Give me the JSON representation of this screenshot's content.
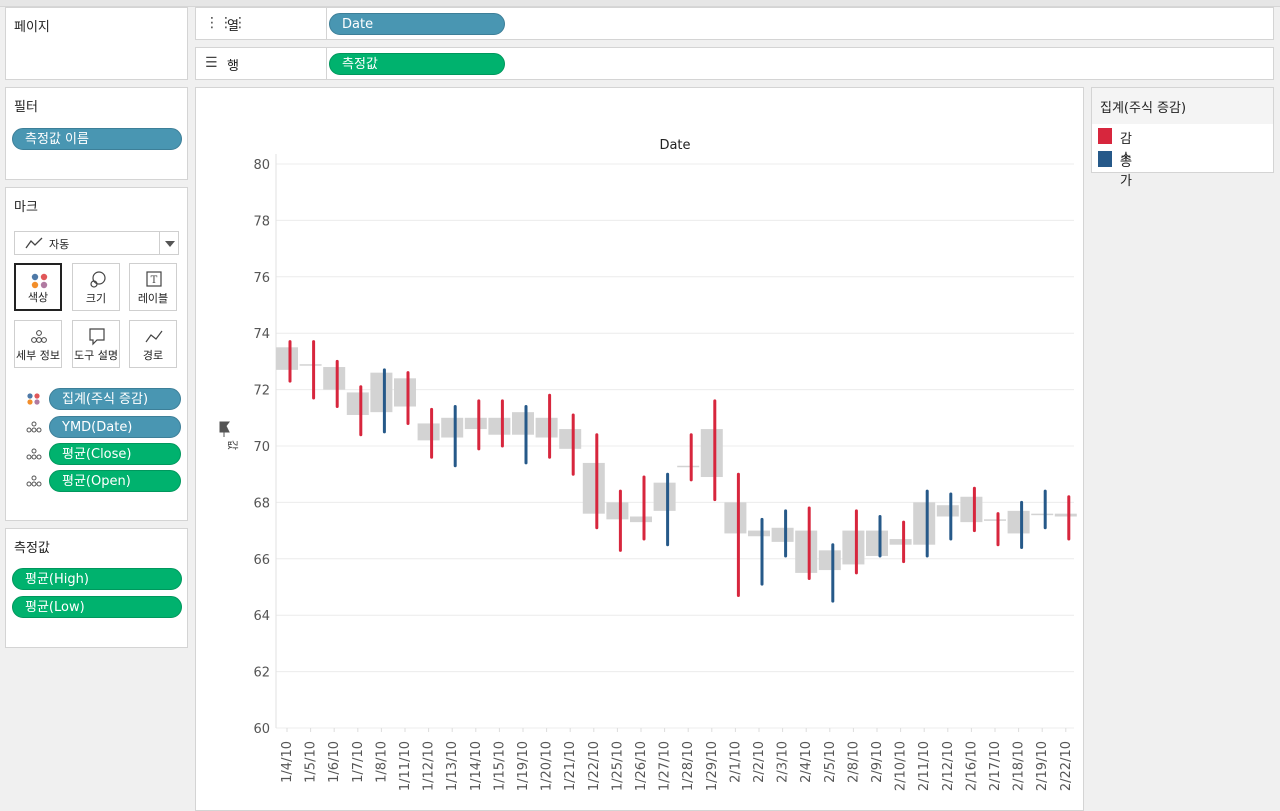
{
  "shelves": {
    "pages_title": "페이지",
    "columns_label": "열",
    "columns_pill": "Date",
    "rows_label": "행",
    "rows_pill": "측정값"
  },
  "filters": {
    "title": "필터",
    "pill": "측정값 이름"
  },
  "marks": {
    "title": "마크",
    "type_dropdown": "자동",
    "buttons": {
      "color": "색상",
      "size": "크기",
      "label": "레이블",
      "detail": "세부 정보",
      "tooltip": "도구 설명",
      "path": "경로"
    },
    "fields": [
      "집계(주식 증감)",
      "YMD(Date)",
      "평균(Close)",
      "평균(Open)"
    ]
  },
  "measures": {
    "title": "측정값",
    "items": [
      "평균(High)",
      "평균(Low)"
    ]
  },
  "legend": {
    "title": "집계(주식 증감)",
    "items": [
      {
        "label": "감소",
        "color": "#d7263d"
      },
      {
        "label": "증가",
        "color": "#265989"
      }
    ]
  },
  "chart_data": {
    "type": "candlestick",
    "title": "Date",
    "ylabel": "값",
    "ylim": [
      60,
      80
    ],
    "yticks": [
      60,
      62,
      64,
      66,
      68,
      70,
      72,
      74,
      76,
      78,
      80
    ],
    "categories": [
      "1/4/10",
      "1/5/10",
      "1/6/10",
      "1/7/10",
      "1/8/10",
      "1/11/10",
      "1/12/10",
      "1/13/10",
      "1/14/10",
      "1/15/10",
      "1/19/10",
      "1/20/10",
      "1/21/10",
      "1/22/10",
      "1/25/10",
      "1/26/10",
      "1/27/10",
      "1/28/10",
      "1/29/10",
      "2/1/10",
      "2/2/10",
      "2/3/10",
      "2/4/10",
      "2/5/10",
      "2/8/10",
      "2/9/10",
      "2/10/10",
      "2/11/10",
      "2/12/10",
      "2/16/10",
      "2/17/10",
      "2/18/10",
      "2/19/10",
      "2/22/10"
    ],
    "series": [
      {
        "name": "감소",
        "color": "#d7263d"
      },
      {
        "name": "증가",
        "color": "#265989"
      }
    ],
    "body_color": "#d3d3d3",
    "candles": [
      {
        "date": "1/4/10",
        "open": 73.5,
        "close": 72.7,
        "high": 73.7,
        "low": 72.3,
        "trend": "감소"
      },
      {
        "date": "1/5/10",
        "open": 72.9,
        "close": 72.9,
        "high": 73.7,
        "low": 71.7,
        "trend": "감소"
      },
      {
        "date": "1/6/10",
        "open": 72.8,
        "close": 72.0,
        "high": 73.0,
        "low": 71.4,
        "trend": "감소"
      },
      {
        "date": "1/7/10",
        "open": 71.9,
        "close": 71.1,
        "high": 72.1,
        "low": 70.4,
        "trend": "감소"
      },
      {
        "date": "1/8/10",
        "open": 71.2,
        "close": 72.6,
        "high": 72.7,
        "low": 70.5,
        "trend": "증가"
      },
      {
        "date": "1/11/10",
        "open": 72.4,
        "close": 71.4,
        "high": 72.6,
        "low": 70.8,
        "trend": "감소"
      },
      {
        "date": "1/12/10",
        "open": 70.8,
        "close": 70.2,
        "high": 71.3,
        "low": 69.6,
        "trend": "감소"
      },
      {
        "date": "1/13/10",
        "open": 70.3,
        "close": 71.0,
        "high": 71.4,
        "low": 69.3,
        "trend": "증가"
      },
      {
        "date": "1/14/10",
        "open": 71.0,
        "close": 70.6,
        "high": 71.6,
        "low": 69.9,
        "trend": "감소"
      },
      {
        "date": "1/15/10",
        "open": 71.0,
        "close": 70.4,
        "high": 71.6,
        "low": 70.0,
        "trend": "감소"
      },
      {
        "date": "1/19/10",
        "open": 70.4,
        "close": 71.2,
        "high": 71.4,
        "low": 69.4,
        "trend": "증가"
      },
      {
        "date": "1/20/10",
        "open": 71.0,
        "close": 70.3,
        "high": 71.8,
        "low": 69.6,
        "trend": "감소"
      },
      {
        "date": "1/21/10",
        "open": 70.6,
        "close": 69.9,
        "high": 71.1,
        "low": 69.0,
        "trend": "감소"
      },
      {
        "date": "1/22/10",
        "open": 69.4,
        "close": 67.6,
        "high": 70.4,
        "low": 67.1,
        "trend": "감소"
      },
      {
        "date": "1/25/10",
        "open": 68.0,
        "close": 67.4,
        "high": 68.4,
        "low": 66.3,
        "trend": "감소"
      },
      {
        "date": "1/26/10",
        "open": 67.5,
        "close": 67.3,
        "high": 68.9,
        "low": 66.7,
        "trend": "감소"
      },
      {
        "date": "1/27/10",
        "open": 67.7,
        "close": 68.7,
        "high": 69.0,
        "low": 66.5,
        "trend": "증가"
      },
      {
        "date": "1/28/10",
        "open": 69.3,
        "close": 69.3,
        "high": 70.4,
        "low": 68.8,
        "trend": "감소"
      },
      {
        "date": "1/29/10",
        "open": 70.6,
        "close": 68.9,
        "high": 71.6,
        "low": 68.1,
        "trend": "감소"
      },
      {
        "date": "2/1/10",
        "open": 68.0,
        "close": 66.9,
        "high": 69.0,
        "low": 64.7,
        "trend": "감소"
      },
      {
        "date": "2/2/10",
        "open": 66.8,
        "close": 67.0,
        "high": 67.4,
        "low": 65.1,
        "trend": "증가"
      },
      {
        "date": "2/3/10",
        "open": 66.6,
        "close": 67.1,
        "high": 67.7,
        "low": 66.1,
        "trend": "증가"
      },
      {
        "date": "2/4/10",
        "open": 67.0,
        "close": 65.5,
        "high": 67.8,
        "low": 65.3,
        "trend": "감소"
      },
      {
        "date": "2/5/10",
        "open": 65.6,
        "close": 66.3,
        "high": 66.5,
        "low": 64.5,
        "trend": "증가"
      },
      {
        "date": "2/8/10",
        "open": 67.0,
        "close": 65.8,
        "high": 67.7,
        "low": 65.5,
        "trend": "감소"
      },
      {
        "date": "2/9/10",
        "open": 66.1,
        "close": 67.0,
        "high": 67.5,
        "low": 66.1,
        "trend": "증가"
      },
      {
        "date": "2/10/10",
        "open": 66.7,
        "close": 66.5,
        "high": 67.3,
        "low": 65.9,
        "trend": "감소"
      },
      {
        "date": "2/11/10",
        "open": 66.5,
        "close": 68.0,
        "high": 68.4,
        "low": 66.1,
        "trend": "증가"
      },
      {
        "date": "2/12/10",
        "open": 67.5,
        "close": 67.9,
        "high": 68.3,
        "low": 66.7,
        "trend": "증가"
      },
      {
        "date": "2/16/10",
        "open": 68.2,
        "close": 67.3,
        "high": 68.5,
        "low": 67.0,
        "trend": "감소"
      },
      {
        "date": "2/17/10",
        "open": 67.4,
        "close": 67.4,
        "high": 67.6,
        "low": 66.5,
        "trend": "감소"
      },
      {
        "date": "2/18/10",
        "open": 66.9,
        "close": 67.7,
        "high": 68.0,
        "low": 66.4,
        "trend": "증가"
      },
      {
        "date": "2/19/10",
        "open": 67.6,
        "close": 67.6,
        "high": 68.4,
        "low": 67.1,
        "trend": "증가"
      },
      {
        "date": "2/22/10",
        "open": 67.6,
        "close": 67.5,
        "high": 68.2,
        "low": 66.7,
        "trend": "감소"
      }
    ]
  }
}
